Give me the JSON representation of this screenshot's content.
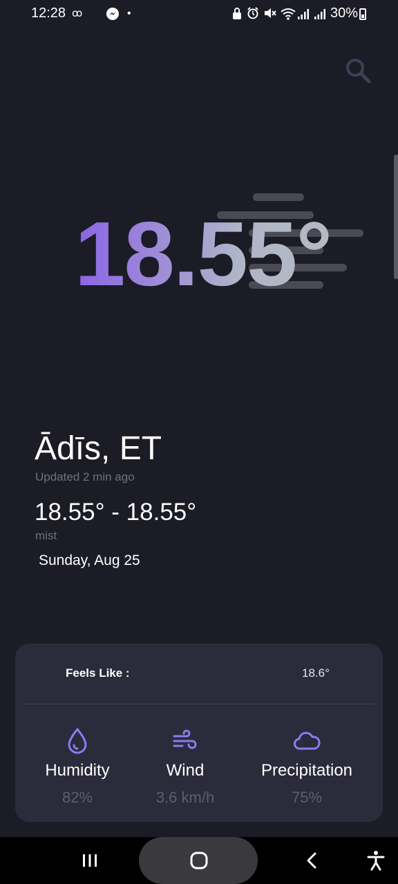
{
  "status_bar": {
    "time": "12:28",
    "battery": "30%",
    "icons": [
      "infinity-icon",
      "messenger-icon",
      "dot-icon",
      "lock-icon",
      "alarm-icon",
      "mute-icon",
      "wifi-icon",
      "signal-icon",
      "signal-icon",
      "battery-icon"
    ]
  },
  "search": {
    "icon": "search-icon"
  },
  "current": {
    "temperature": "18.55°",
    "weather_icon": "mist-icon",
    "location": "Ādīs, ET",
    "updated": "Updated 2 min ago",
    "range": "18.55° - 18.55°",
    "condition": "mist",
    "date": "Sunday, Aug 25"
  },
  "details": {
    "feels_like_label": "Feels Like :",
    "feels_like_value": "18.6°",
    "metrics": [
      {
        "icon": "droplet-icon",
        "label": "Humidity",
        "value": "82%"
      },
      {
        "icon": "wind-icon",
        "label": "Wind",
        "value": "3.6 km/h"
      },
      {
        "icon": "cloud-icon",
        "label": "Precipitation",
        "value": "75%"
      }
    ]
  },
  "nav_bar": {
    "items": [
      "recents-icon",
      "home-icon",
      "back-icon",
      "accessibility-icon"
    ]
  },
  "colors": {
    "background": "#1c1c26",
    "card": "#2b2b3b",
    "accent": "#8b7cf0",
    "muted_text": "#6f6f7f"
  }
}
